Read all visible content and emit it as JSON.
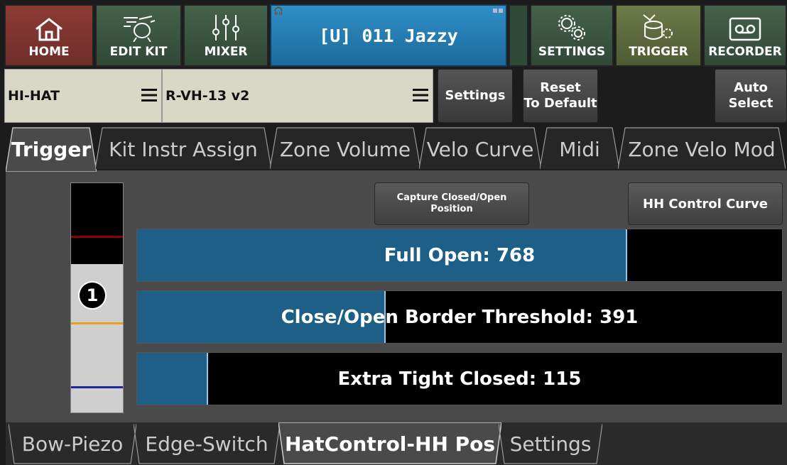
{
  "nav": {
    "home": "HOME",
    "edit_kit": "EDIT KIT",
    "mixer": "MIXER",
    "kit_name": "[U] 011 Jazzy",
    "settings": "SETTINGS",
    "trigger": "TRIGGER",
    "recorder": "RECORDER"
  },
  "selectors": {
    "instrument": "HI-HAT",
    "trigger_model": "R-VH-13 v2"
  },
  "actions": {
    "settings": "Settings",
    "reset_line1": "Reset",
    "reset_line2": "To Default",
    "auto_line1": "Auto",
    "auto_line2": "Select"
  },
  "tabs": [
    "Trigger",
    "Kit Instr Assign",
    "Zone Volume",
    "Velo Curve",
    "Midi",
    "Zone Velo Mod"
  ],
  "panel": {
    "capture_line1": "Capture Closed/Open",
    "capture_line2": "Position",
    "hh_curve": "HH Control Curve",
    "badge": "1",
    "bars": [
      {
        "label": "Full Open: 768",
        "fraction": 0.76
      },
      {
        "label": "Close/Open Border Threshold: 391",
        "fraction": 0.385
      },
      {
        "label": "Extra Tight Closed: 115",
        "fraction": 0.11
      }
    ]
  },
  "bottom_tabs": [
    "Bow-Piezo",
    "Edge-Switch",
    "HatControl-HH Pos",
    "Settings"
  ],
  "colors": {
    "home": "#7c3430",
    "nav_green": "#3a5840",
    "nav_active": "#5a6a3a",
    "kit_blue": "#2a86c0",
    "bar_fill": "#1d5f87"
  }
}
